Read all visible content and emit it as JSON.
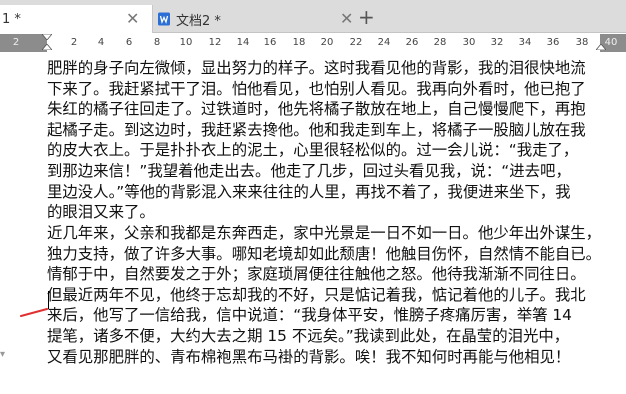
{
  "tabs": [
    {
      "label": "1 *",
      "active": true
    },
    {
      "label": "文档2 *",
      "active": false
    }
  ],
  "tab_close_glyph": "✕",
  "new_tab_glyph": "+",
  "ruler": {
    "labels": [
      "2",
      "2",
      "4",
      "6",
      "8",
      "10",
      "12",
      "14",
      "16",
      "18",
      "20",
      "22",
      "24",
      "26",
      "28",
      "30",
      "32",
      "34",
      "36",
      "38",
      "40"
    ]
  },
  "document": {
    "lines": [
      "肥胖的身子向左微倾，显出努力的样子。这时我看见他的背影，我的泪很快地流",
      "下来了。我赶紧拭干了泪。怕他看见，也怕别人看见。我再向外看时，他已抱了",
      "朱红的橘子往回走了。过铁道时，他先将橘子散放在地上，自己慢慢爬下，再抱",
      "起橘子走。到这边时，我赶紧去搀他。他和我走到车上，将橘子一股脑儿放在我",
      "的皮大衣上。于是扑扑衣上的泥土，心里很轻松似的。过一会儿说：“我走了，",
      "到那边来信！”我望着他走出去。他走了几步，回过头看见我，说：“进去吧，",
      "里边没人。”等他的背影混入来来往往的人里，再找不着了，我便进来坐下，我",
      "的眼泪又来了。",
      "近几年来，父亲和我都是东奔西走，家中光景是一日不如一日。他少年出外谋生，",
      "独力支持，做了许多大事。哪知老境却如此颓唐！他触目伤怀，自然情不能自已。",
      "情郁于中，自然要发之于外；家庭琐屑便往往触他之怒。他待我渐渐不同往日。",
      "但最近两年不见，他终于忘却我的不好，只是惦记着我，惦记着他的儿子。我北",
      "来后，他写了一信给我，信中说道：“我身体平安，惟膀子疼痛厉害，举箸 14",
      "提笔，诸多不便，大约大去之期 15 不远矣。”我读到此处，在晶莹的泪光中，",
      "又看见那肥胖的、青布棉袍黑布马褂的背影。唉！我不知何时再能与他相见！"
    ]
  },
  "colors": {
    "tabbar_bg": "#dcdcdc",
    "ruler_margin": "#8c8c8c",
    "ink_stroke": "#e03030",
    "doc_icon": "#2b6fd6"
  },
  "icons": {
    "doc_tab_icon": "word-document-icon",
    "paragraph_mark": "paragraph-mark-icon"
  }
}
